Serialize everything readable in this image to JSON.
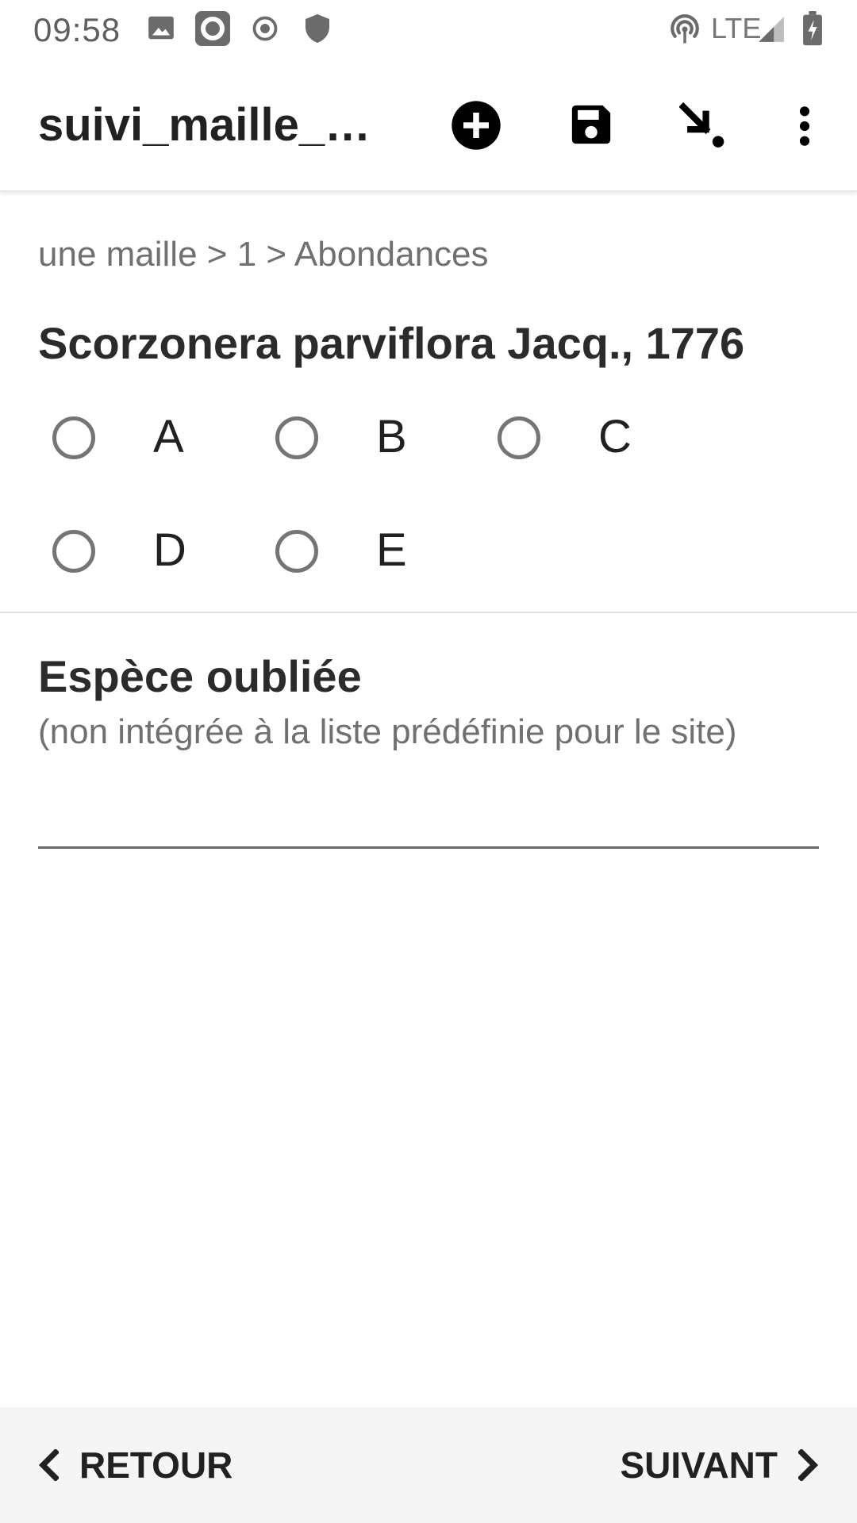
{
  "status_bar": {
    "time": "09:58",
    "network": "LTE",
    "icons": [
      "image-icon",
      "record-icon",
      "location-target-icon",
      "shield-icon",
      "hotspot-icon",
      "signal-icon",
      "battery-charging-icon"
    ]
  },
  "app_bar": {
    "title": "suivi_maille_b…",
    "actions": [
      "add-circle-icon",
      "save-icon",
      "jump-arrow-icon",
      "more-vert-icon"
    ]
  },
  "breadcrumb": "une maille > 1 > Abondances",
  "species": {
    "title": "Scorzonera parviflora Jacq., 1776",
    "options": [
      {
        "label": "A",
        "selected": false
      },
      {
        "label": "B",
        "selected": false
      },
      {
        "label": "C",
        "selected": false
      },
      {
        "label": "D",
        "selected": false
      },
      {
        "label": "E",
        "selected": false
      }
    ]
  },
  "forgotten_species": {
    "title": "Espèce oubliée",
    "hint": "(non intégrée à la liste prédéfinie pour le site)",
    "value": ""
  },
  "navigation": {
    "back_label": "RETOUR",
    "next_label": "SUIVANT"
  },
  "colors": {
    "text": "#212121",
    "secondary_text": "#707070",
    "radio_border": "#757575",
    "bottom_bar": "#f5f5f5"
  }
}
